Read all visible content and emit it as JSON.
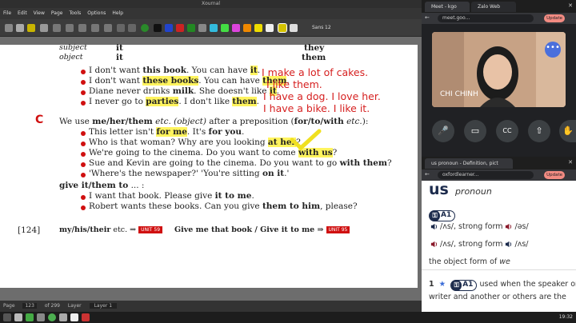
{
  "xournal": {
    "title": "Xournal",
    "menu": [
      "File",
      "Edit",
      "View",
      "Page",
      "Tools",
      "Options",
      "Help"
    ],
    "font_label": "Sans",
    "font_size": "12",
    "status": {
      "page_label": "Page",
      "page_value": "123",
      "of_pages": "of 299",
      "layer_label": "Layer",
      "layer_value": "Layer 1"
    }
  },
  "book": {
    "table_header": {
      "row1_left": "subject",
      "row1_mid": "it",
      "row1_right": "they",
      "row2_left": "object",
      "row2_mid": "it",
      "row2_right": "them"
    },
    "lines_a": [
      {
        "p1": "I don't want ",
        "b1": "this book",
        "p2": ". You can have ",
        "b2": "it",
        "p3": "."
      },
      {
        "p1": "I don't want ",
        "b1": "these books",
        "p2": ". You can have ",
        "b2": "them",
        "p3": "."
      },
      {
        "p1": "Diane never drinks ",
        "b1": "milk",
        "p2": ". She doesn't like ",
        "b2": "it",
        "p3": "."
      },
      {
        "p1": "I never go to ",
        "b1": "parties",
        "p2": ". I don't like ",
        "b2": "them",
        "p3": "."
      }
    ],
    "section_letter": "C",
    "section_c_text_1": "We use ",
    "section_c_bold": "me/her/them",
    "section_c_italic": " etc. (object)",
    "section_c_text_2": " after a preposition (",
    "section_c_bold2": "for/to/with",
    "section_c_italic2": " etc.",
    "section_c_text_3": "):",
    "lines_c": [
      {
        "p1": "This letter isn't ",
        "b1": "for me",
        "p2": ". It's ",
        "b2": "for you",
        "p3": "."
      },
      {
        "p1": "Who is that woman? Why are you looking ",
        "b1": "at her",
        "p2": "?",
        "b2": "",
        "p3": ""
      },
      {
        "p1": "We're going to the cinema. Do you want to come ",
        "b1": "with us",
        "p2": "?",
        "b2": "",
        "p3": ""
      },
      {
        "p1": "Sue and Kevin are going to the cinema. Do you want to go ",
        "b1": "with them",
        "p2": "?",
        "b2": "",
        "p3": ""
      },
      {
        "p1": "'Where's the newspaper?'    'You're sitting ",
        "b1": "on it",
        "p2": ".'",
        "b2": "",
        "p3": ""
      }
    ],
    "give_heading": "give it/them to",
    "give_heading_tail": " ... :",
    "lines_g": [
      {
        "p1": "I want that book. Please give ",
        "b1": "it to me",
        "p2": "."
      },
      {
        "p1": "Robert wants these books. Can you give ",
        "b1": "them to him",
        "p2": ", please?"
      }
    ],
    "page_number": "[124]",
    "footer_left": "my/his/their",
    "footer_left_tail": " etc. ⇒",
    "unit_a": "UNIT 59",
    "footer_mid": "Give me that book / Give it to me ⇒",
    "unit_b": "UNIT 95",
    "handwriting": [
      "I make a lot of cakes.",
      "I like them.",
      "I have a dog. I love her.",
      "I have a bike. I like it."
    ]
  },
  "meet": {
    "tab1": "Meet - kgo",
    "tab2": "Zalo Web",
    "url": "meet.goo...",
    "update": "Update",
    "participant": "CHI CHINH"
  },
  "dict": {
    "tab": "us pronoun - Definition, pict",
    "url": "oxfordlearner...",
    "update": "Update",
    "headword": "us",
    "pos": "pronoun",
    "level": "A1",
    "pron_strong_1": "/ʌs/, strong form",
    "pron_weak_1": "/əs/",
    "pron_strong_2": "/ʌs/, strong form",
    "pron_weak_2": "/ʌs/",
    "def_intro": "the object form of ",
    "def_intro_word": "we",
    "sense_num": "1",
    "sense_level": "A1",
    "sense_text_1": "used when the speaker or",
    "sense_text_2": "writer and another or others are the"
  },
  "taskbar": {
    "clock": "19:32"
  },
  "colors": {
    "accent_red": "#d01010",
    "handwriting_red": "#d62020",
    "highlight": "#fff028",
    "oxford_navy": "#1c2b4c"
  }
}
